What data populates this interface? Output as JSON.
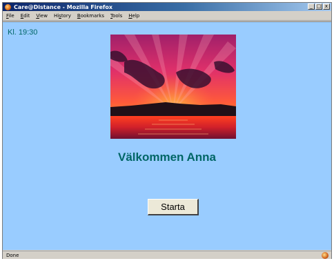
{
  "window": {
    "title": "Care@Distance - Mozilla Firefox",
    "minimize_glyph": "_",
    "maximize_glyph": "□",
    "close_glyph": "x"
  },
  "menu": {
    "items": [
      {
        "key": "F",
        "rest": "ile"
      },
      {
        "key": "E",
        "rest": "dit"
      },
      {
        "key": "V",
        "rest": "iew"
      },
      {
        "key": "",
        "rest": "Hi",
        "key2": "s",
        "rest2": "tory"
      },
      {
        "key": "B",
        "rest": "ookmarks"
      },
      {
        "key": "T",
        "rest": "ools"
      },
      {
        "key": "H",
        "rest": "elp"
      }
    ]
  },
  "page": {
    "clock": "Kl. 19:30",
    "welcome": "Välkommen Anna",
    "start_button": "Starta",
    "background_color": "#99ccff",
    "accent_color": "#006666"
  },
  "status": {
    "text": "Done"
  }
}
